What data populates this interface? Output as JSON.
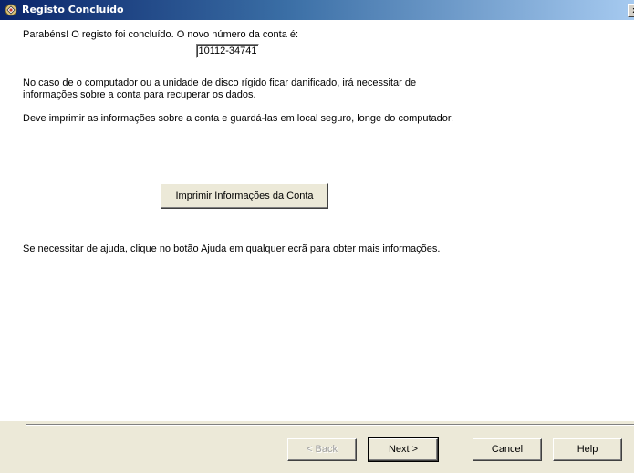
{
  "window": {
    "title": "Registo Concluído",
    "close_glyph": "x",
    "title_icon": "registration-app-icon"
  },
  "content": {
    "congrats_text": "Parabéns!  O registo foi concluído.  O novo número da conta é:",
    "account_number": "10112-34741",
    "damage_warning": "No caso de o computador ou a unidade de disco rígido ficar danificado, irá necessitar de informações sobre a conta para recuperar os dados.",
    "print_advice": "Deve imprimir as informações sobre a conta e guardá-las em local seguro, longe do computador.",
    "print_button_label": "Imprimir Informações da Conta",
    "help_text": "Se necessitar de ajuda, clique no botão Ajuda em qualquer ecrã para obter mais informações."
  },
  "footer": {
    "back_label": "< Back",
    "next_label": "Next >",
    "cancel_label": "Cancel",
    "help_label": "Help"
  },
  "colors": {
    "titlebar_start": "#0a246a",
    "titlebar_end": "#a6caf0",
    "dialog_face": "#ece9d8",
    "content_bg": "#ffffff"
  }
}
